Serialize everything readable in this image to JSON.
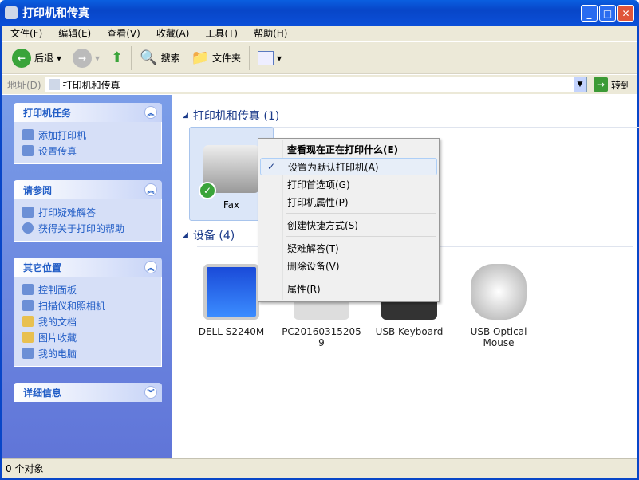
{
  "window": {
    "title": "打印机和传真"
  },
  "menu": [
    "文件(F)",
    "编辑(E)",
    "查看(V)",
    "收藏(A)",
    "工具(T)",
    "帮助(H)"
  ],
  "toolbar": {
    "back": "后退",
    "search": "搜索",
    "folders": "文件夹"
  },
  "address": {
    "label": "地址(D)",
    "value": "打印机和传真",
    "go": "转到"
  },
  "sidebar": {
    "printer_tasks": {
      "title": "打印机任务",
      "items": [
        "添加打印机",
        "设置传真"
      ]
    },
    "see_also": {
      "title": "请参阅",
      "items": [
        "打印疑难解答",
        "获得关于打印的帮助"
      ]
    },
    "other_places": {
      "title": "其它位置",
      "items": [
        "控制面板",
        "扫描仪和照相机",
        "我的文档",
        "图片收藏",
        "我的电脑"
      ]
    },
    "details": {
      "title": "详细信息"
    }
  },
  "groups": {
    "printers": "打印机和传真 (1)",
    "devices": "设备 (4)"
  },
  "printers": [
    {
      "name": "Fax",
      "default": true
    }
  ],
  "devices": [
    "DELL S2240M",
    "PC20160315205 9",
    "USB Keyboard",
    "USB Optical Mouse"
  ],
  "context_menu": [
    "查看现在正在打印什么(E)",
    "设置为默认打印机(A)",
    "打印首选项(G)",
    "打印机属性(P)",
    "创建快捷方式(S)",
    "疑难解答(T)",
    "删除设备(V)",
    "属性(R)"
  ],
  "status": "0 个对象"
}
